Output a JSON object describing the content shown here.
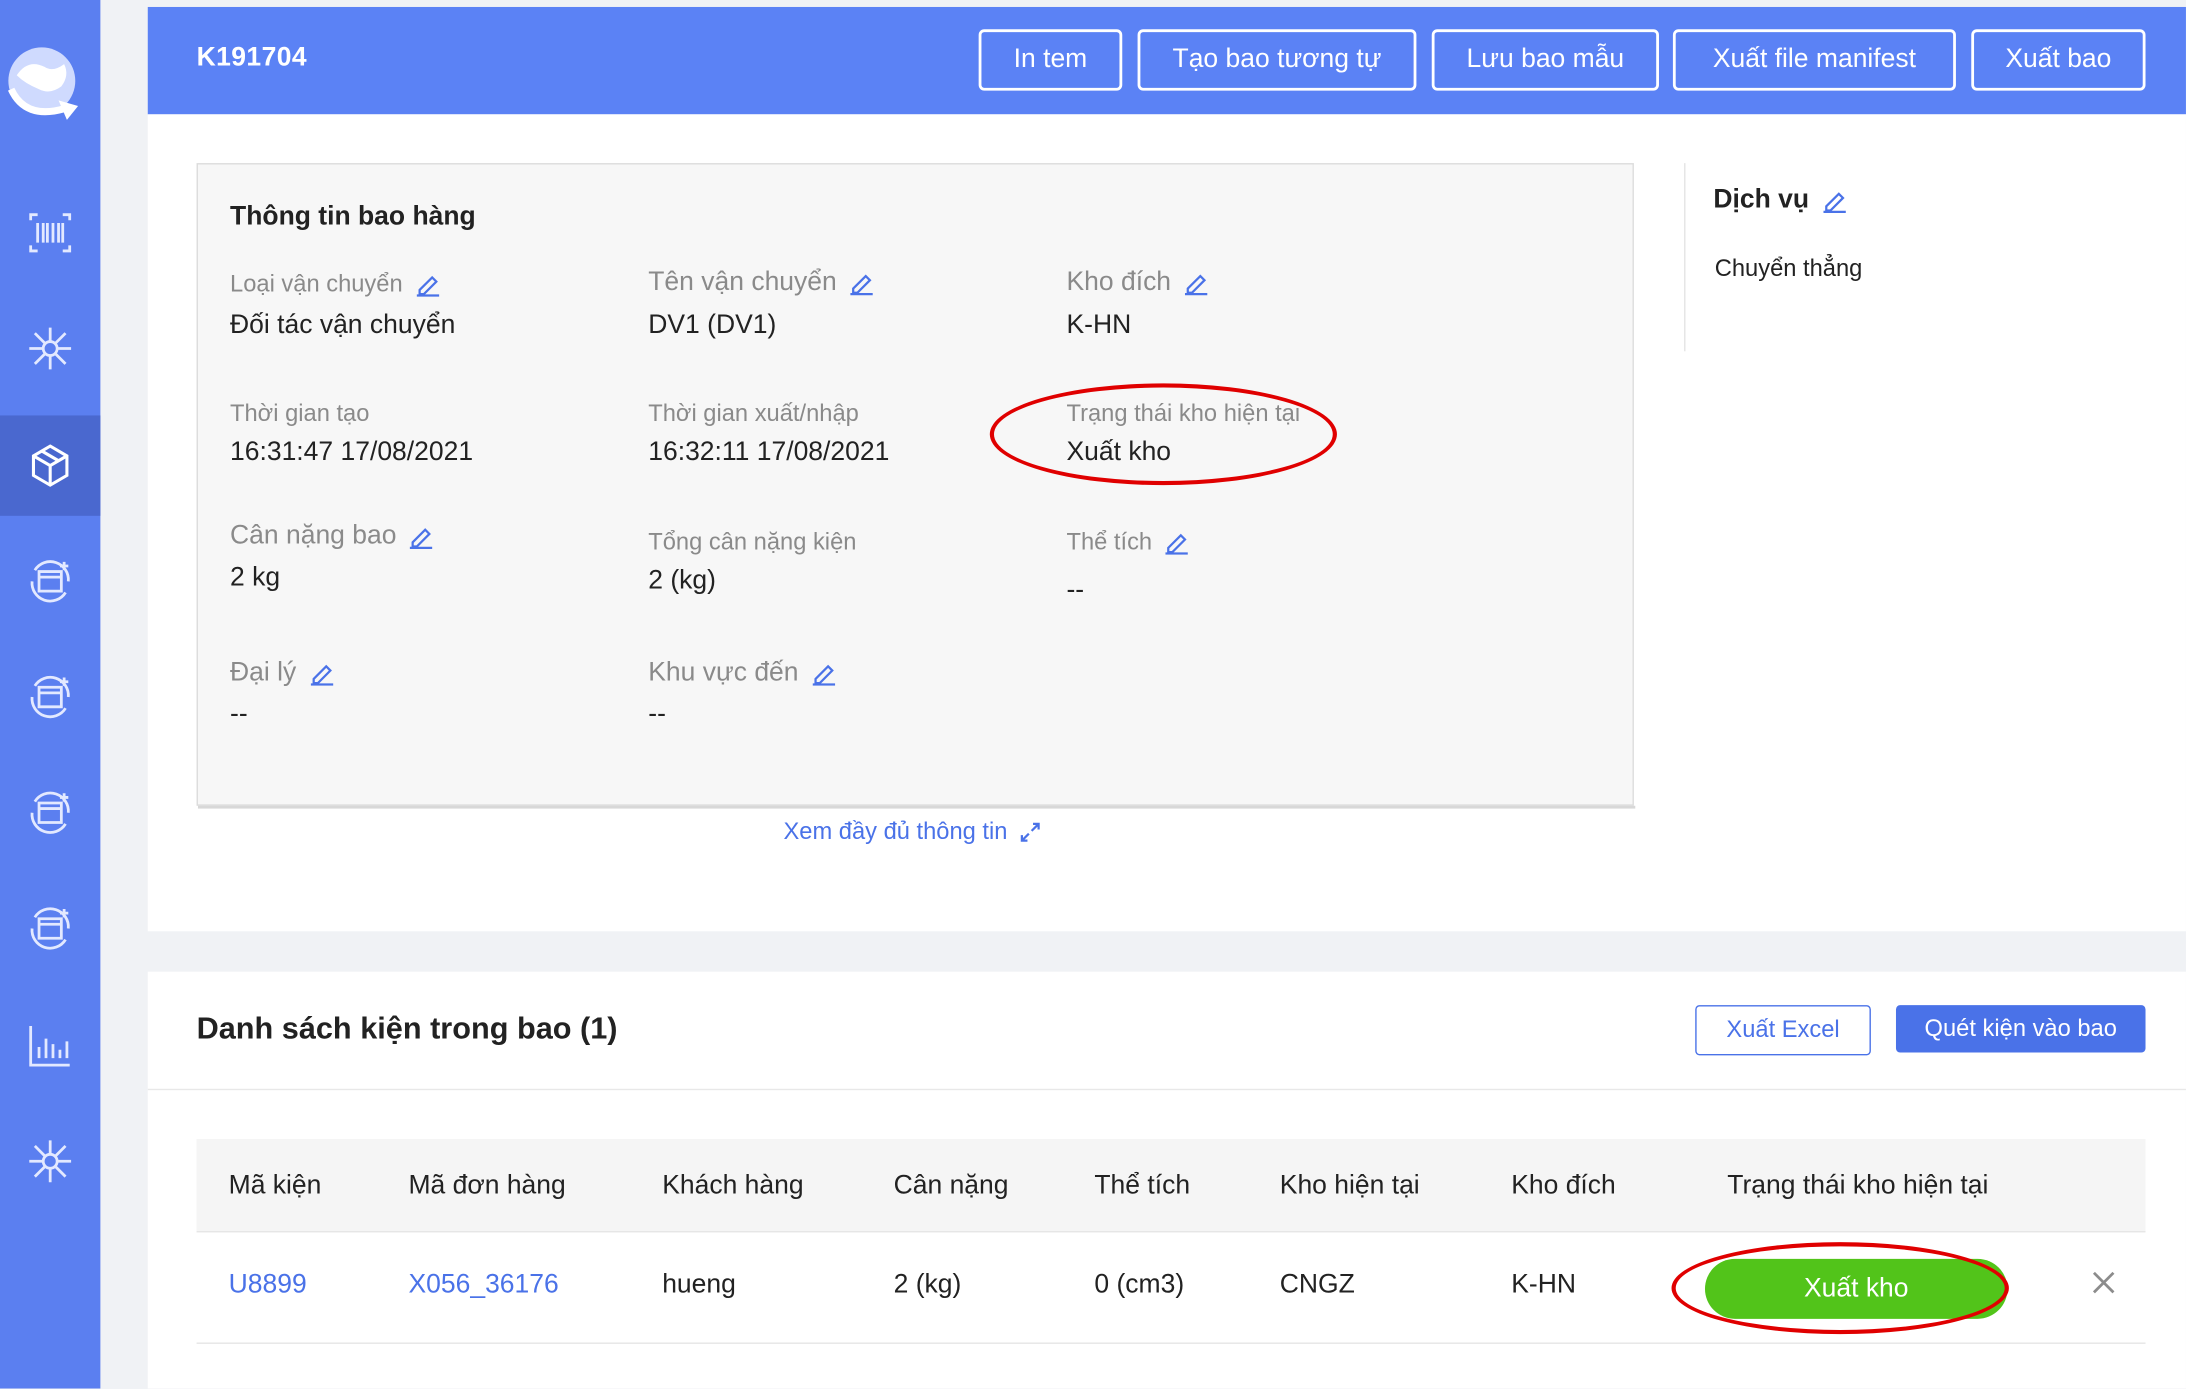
{
  "header": {
    "title": "K191704",
    "buttons": [
      "In tem",
      "Tạo bao tương tự",
      "Lưu bao mẫu",
      "Xuất file manifest",
      "Xuất bao"
    ]
  },
  "info": {
    "title": "Thông tin bao hàng",
    "fields": [
      {
        "label": "Loại vận chuyển",
        "value": "Đối tác vận chuyển",
        "editable": true
      },
      {
        "label": "Tên vận chuyển",
        "value": "DV1 (DV1)",
        "editable": true
      },
      {
        "label": "Kho đích",
        "value": "K-HN",
        "editable": true
      },
      {
        "label": "Thời gian tạo",
        "value": "16:31:47 17/08/2021",
        "editable": false
      },
      {
        "label": "Thời gian xuất/nhập",
        "value": "16:32:11 17/08/2021",
        "editable": false
      },
      {
        "label": "Trạng thái kho hiện tại",
        "value": "Xuất kho",
        "editable": false,
        "highlighted": true
      },
      {
        "label": "Cân nặng bao",
        "value": "2 kg",
        "editable": true
      },
      {
        "label": "Tổng cân nặng kiện",
        "value": "2 (kg)",
        "editable": false
      },
      {
        "label": "Thể tích",
        "value": "--",
        "editable": true
      },
      {
        "label": "Đại lý",
        "value": "--",
        "editable": true
      },
      {
        "label": "Khu vực đến",
        "value": "--",
        "editable": true
      }
    ],
    "view_more": "Xem đầy đủ thông tin"
  },
  "service": {
    "title": "Dịch vụ",
    "value": "Chuyển thẳng"
  },
  "package_list": {
    "title": "Danh sách kiện trong bao (1)",
    "export_excel": "Xuất Excel",
    "scan_button": "Quét kiện vào bao",
    "columns": [
      "Mã kiện",
      "Mã đơn hàng",
      "Khách hàng",
      "Cân nặng",
      "Thể tích",
      "Kho hiện tại",
      "Kho đích",
      "Trạng thái kho hiện tại"
    ],
    "rows": [
      {
        "package_code": "U8899",
        "order_code": "X056_36176",
        "customer": "hueng",
        "weight": "2 (kg)",
        "volume": "0 (cm3)",
        "current_warehouse": "CNGZ",
        "destination_warehouse": "K-HN",
        "status": "Xuất kho"
      }
    ]
  },
  "colors": {
    "sidebar": "#5b7ff0",
    "header": "#5b82f5",
    "accent": "#4a72e8",
    "status_green": "#52c41a",
    "highlight_red": "#e00000"
  }
}
